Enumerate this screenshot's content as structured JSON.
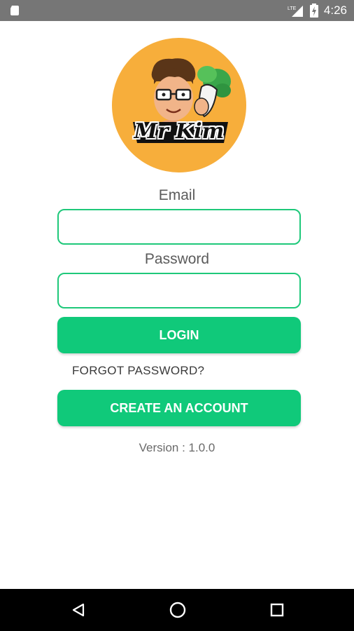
{
  "status_bar": {
    "time": "4:26",
    "network": "LTE",
    "icons": [
      "sd-card-icon",
      "signal-icon",
      "battery-charging-icon"
    ]
  },
  "logo": {
    "text": "Mr Kim",
    "background_color": "#f7ae3b"
  },
  "form": {
    "email_label": "Email",
    "email_value": "",
    "password_label": "Password",
    "password_value": ""
  },
  "buttons": {
    "login": "LOGIN",
    "forgot_password": "FORGOT PASSWORD?",
    "create_account": "CREATE AN ACCOUNT"
  },
  "version_text": "Version : 1.0.0",
  "nav_bar": {
    "icons": [
      "back-icon",
      "home-icon",
      "recents-icon"
    ]
  },
  "colors": {
    "accent": "#10c97a",
    "field_border": "#1ec87a",
    "status_bar": "#767676",
    "nav_bar": "#000000"
  }
}
